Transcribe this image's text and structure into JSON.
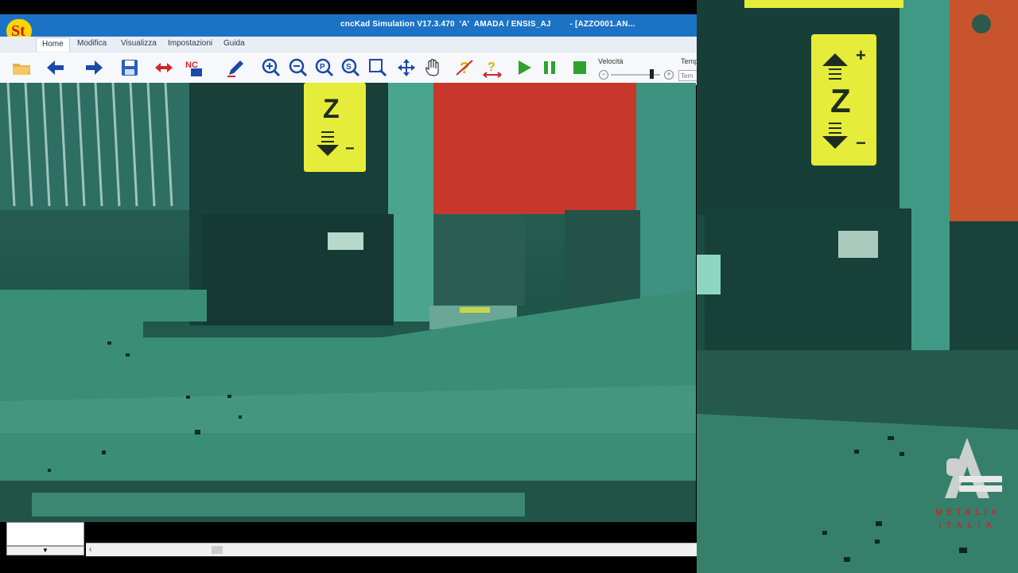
{
  "window": {
    "title": "cncKad Simulation V17.3.470  'A'  AMADA / ENSIS_AJ        - [AZZO001.AN..."
  },
  "logo": {
    "letters": "St"
  },
  "tabs": [
    {
      "label": "Home",
      "active": true
    },
    {
      "label": "Modifica"
    },
    {
      "label": "Visualizza"
    },
    {
      "label": "Impostazioni"
    },
    {
      "label": "Guida"
    }
  ],
  "toolbar": {
    "icons": [
      "open-folder-icon",
      "arrow-left-icon",
      "arrow-right-icon",
      "save-icon",
      "double-arrow-icon",
      "nc-icon",
      "pencil-icon",
      "zoom-in-icon",
      "zoom-out-icon",
      "zoom-p-icon",
      "zoom-s-icon",
      "zoom-window-icon",
      "pan-icon",
      "hand-icon",
      "question-icon",
      "question-arrow-icon",
      "play-icon",
      "pause-icon",
      "stop-icon"
    ],
    "speed_label": "Velocità",
    "speed_minus": "−",
    "speed_plus": "+",
    "temp_label": "Temp",
    "temp_placeholder": "Tem",
    "colors": {
      "blue": "#1c49a8",
      "red": "#d0262a",
      "green": "#2fa12f"
    }
  },
  "video_left": {
    "z_plate": {
      "letter": "Z",
      "minus": "−"
    }
  },
  "video_right": {
    "z_plate": {
      "letter": "Z",
      "plus": "+",
      "minus": "−"
    }
  },
  "bottom": {
    "dropdown_glyph": "▼",
    "scroll_left_glyph": "‹"
  },
  "watermark": {
    "line1": "METALIX",
    "line2": "ITALIA",
    "color": "#c7262c"
  }
}
